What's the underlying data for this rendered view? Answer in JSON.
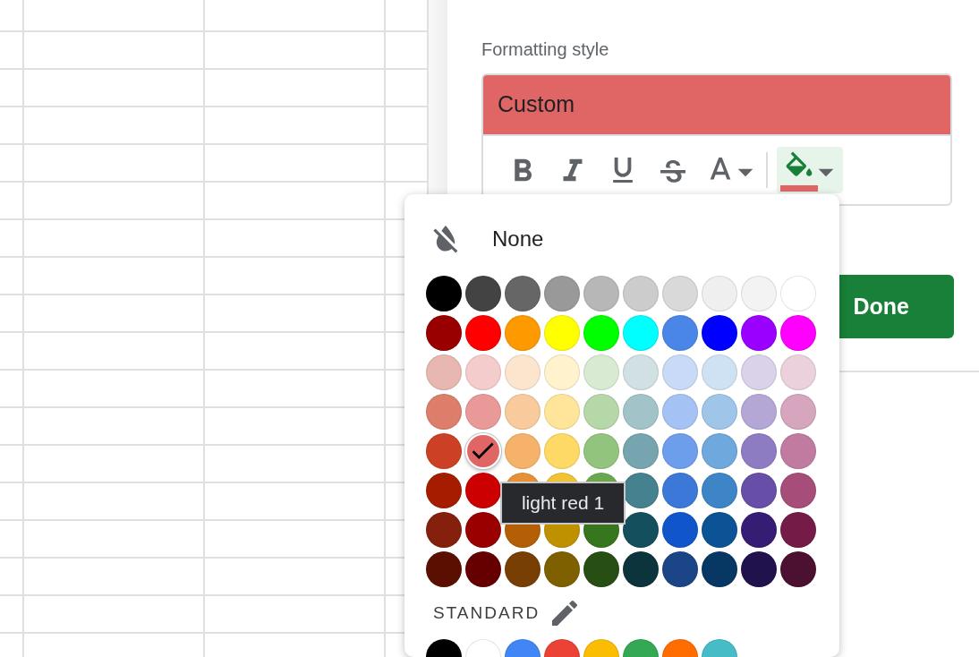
{
  "panel": {
    "section_label": "Formatting style",
    "style_preview": {
      "text": "Custom"
    },
    "toolbar": [
      {
        "kind": "bold",
        "active": false
      },
      {
        "kind": "italic",
        "active": false
      },
      {
        "kind": "underline",
        "active": false
      },
      {
        "kind": "strikethrough",
        "active": false
      },
      {
        "kind": "text_color",
        "active": false
      },
      {
        "kind": "fill_color",
        "active": true,
        "color": "#e06666"
      }
    ],
    "done_button": "Done"
  },
  "color_menu": {
    "none_label": "None",
    "rows": [
      {
        "swatches": [
          {
            "color": "#000000",
            "selected": false
          },
          {
            "color": "#434343",
            "selected": false
          },
          {
            "color": "#666666",
            "selected": false
          },
          {
            "color": "#999999",
            "selected": false
          },
          {
            "color": "#b7b7b7",
            "selected": false
          },
          {
            "color": "#cccccc",
            "selected": false
          },
          {
            "color": "#d9d9d9",
            "selected": false
          },
          {
            "color": "#efefef",
            "selected": false
          },
          {
            "color": "#f3f3f3",
            "selected": false
          },
          {
            "color": "#ffffff",
            "selected": false
          }
        ]
      },
      {
        "swatches": [
          {
            "color": "#980000",
            "selected": false
          },
          {
            "color": "#ff0000",
            "selected": false
          },
          {
            "color": "#ff9900",
            "selected": false
          },
          {
            "color": "#ffff00",
            "selected": false
          },
          {
            "color": "#00ff00",
            "selected": false
          },
          {
            "color": "#00ffff",
            "selected": false
          },
          {
            "color": "#4a86e8",
            "selected": false
          },
          {
            "color": "#0000ff",
            "selected": false
          },
          {
            "color": "#9900ff",
            "selected": false
          },
          {
            "color": "#ff00ff",
            "selected": false
          }
        ]
      },
      {
        "swatches": [
          {
            "color": "#e6b8af",
            "selected": false
          },
          {
            "color": "#f4cccc",
            "selected": false
          },
          {
            "color": "#fce5cd",
            "selected": false
          },
          {
            "color": "#fff2cc",
            "selected": false
          },
          {
            "color": "#d9ead3",
            "selected": false
          },
          {
            "color": "#d0e0e3",
            "selected": false
          },
          {
            "color": "#c9daf8",
            "selected": false
          },
          {
            "color": "#cfe2f3",
            "selected": false
          },
          {
            "color": "#d9d2e9",
            "selected": false
          },
          {
            "color": "#ead1dc",
            "selected": false
          }
        ]
      },
      {
        "swatches": [
          {
            "color": "#dd7e6b",
            "selected": false
          },
          {
            "color": "#ea9999",
            "selected": false
          },
          {
            "color": "#f9cb9c",
            "selected": false
          },
          {
            "color": "#ffe599",
            "selected": false
          },
          {
            "color": "#b6d7a8",
            "selected": false
          },
          {
            "color": "#a2c4c9",
            "selected": false
          },
          {
            "color": "#a4c2f4",
            "selected": false
          },
          {
            "color": "#9fc5e8",
            "selected": false
          },
          {
            "color": "#b4a7d6",
            "selected": false
          },
          {
            "color": "#d5a6bd",
            "selected": false
          }
        ]
      },
      {
        "swatches": [
          {
            "color": "#cc4125",
            "selected": false
          },
          {
            "color": "#e06666",
            "selected": true
          },
          {
            "color": "#f6b26b",
            "selected": false
          },
          {
            "color": "#ffd966",
            "selected": false
          },
          {
            "color": "#93c47d",
            "selected": false
          },
          {
            "color": "#76a5af",
            "selected": false
          },
          {
            "color": "#6d9eeb",
            "selected": false
          },
          {
            "color": "#6fa8dc",
            "selected": false
          },
          {
            "color": "#8e7cc3",
            "selected": false
          },
          {
            "color": "#c27ba0",
            "selected": false
          }
        ]
      },
      {
        "swatches": [
          {
            "color": "#a61c00",
            "selected": false
          },
          {
            "color": "#cc0000",
            "selected": false
          },
          {
            "color": "#e69138",
            "selected": false
          },
          {
            "color": "#f1c232",
            "selected": false
          },
          {
            "color": "#6aa84f",
            "selected": false
          },
          {
            "color": "#45818e",
            "selected": false
          },
          {
            "color": "#3c78d8",
            "selected": false
          },
          {
            "color": "#3d85c6",
            "selected": false
          },
          {
            "color": "#674ea7",
            "selected": false
          },
          {
            "color": "#a64d79",
            "selected": false
          }
        ]
      },
      {
        "swatches": [
          {
            "color": "#85200c",
            "selected": false
          },
          {
            "color": "#990000",
            "selected": false
          },
          {
            "color": "#b45f06",
            "selected": false
          },
          {
            "color": "#bf9000",
            "selected": false
          },
          {
            "color": "#38761d",
            "selected": false
          },
          {
            "color": "#134f5c",
            "selected": false
          },
          {
            "color": "#1155cc",
            "selected": false
          },
          {
            "color": "#0b5394",
            "selected": false
          },
          {
            "color": "#351c75",
            "selected": false
          },
          {
            "color": "#741b47",
            "selected": false
          }
        ]
      },
      {
        "swatches": [
          {
            "color": "#5b0f00",
            "selected": false
          },
          {
            "color": "#660000",
            "selected": false
          },
          {
            "color": "#783f04",
            "selected": false
          },
          {
            "color": "#7f6000",
            "selected": false
          },
          {
            "color": "#274e13",
            "selected": false
          },
          {
            "color": "#0c343d",
            "selected": false
          },
          {
            "color": "#1c4587",
            "selected": false
          },
          {
            "color": "#073763",
            "selected": false
          },
          {
            "color": "#20124d",
            "selected": false
          },
          {
            "color": "#4c1130",
            "selected": false
          }
        ]
      }
    ],
    "standard_label": "STANDARD",
    "standard_swatches": [
      {
        "color": "#000000",
        "selected": false
      },
      {
        "color": "#ffffff",
        "selected": false
      },
      {
        "color": "#4285f4",
        "selected": false
      },
      {
        "color": "#ea4335",
        "selected": false
      },
      {
        "color": "#fbbc04",
        "selected": false
      },
      {
        "color": "#34a853",
        "selected": false
      },
      {
        "color": "#ff6d01",
        "selected": false
      },
      {
        "color": "#46bdc6",
        "selected": false
      }
    ],
    "tooltip": "light red 1"
  }
}
